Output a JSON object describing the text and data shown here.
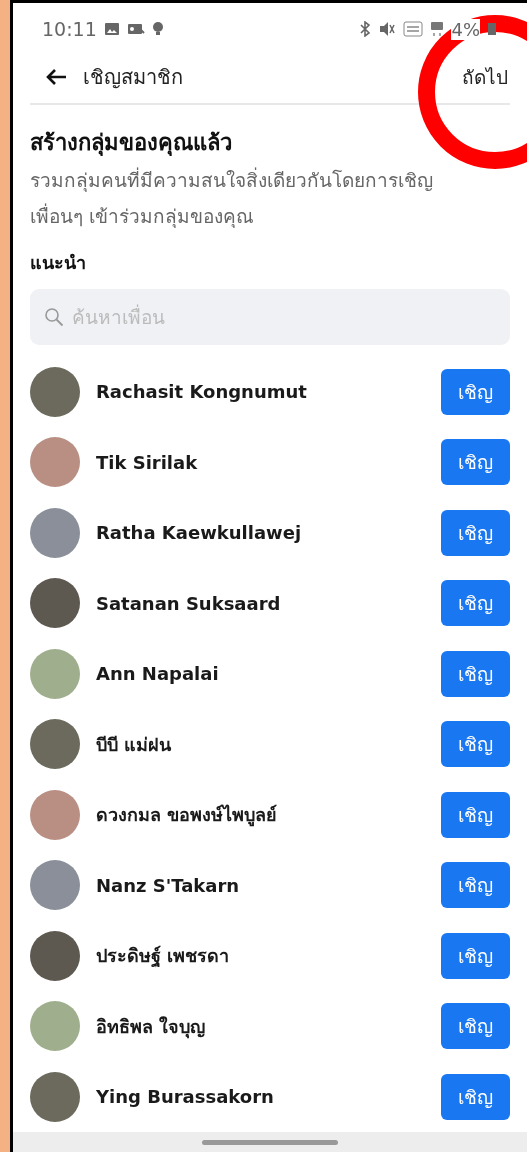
{
  "status_bar": {
    "time": "10:11",
    "battery": "4%"
  },
  "header": {
    "title": "เชิญสมาชิก",
    "action": "ถัดไป"
  },
  "intro": {
    "title": "สร้างกลุ่มของคุณแล้ว",
    "text": "รวมกลุ่มคนที่มีความสนใจสิ่งเดียวกันโดยการเชิญเพื่อนๆ เข้าร่วมกลุ่มของคุณ"
  },
  "section_title": "แนะนำ",
  "search": {
    "placeholder": "ค้นหาเพื่อน"
  },
  "friends": [
    {
      "name": "Rachasit Kongnumut",
      "button": "เชิญ"
    },
    {
      "name": "Tik Sirilak",
      "button": "เชิญ"
    },
    {
      "name": "Ratha Kaewkullawej",
      "button": "เชิญ"
    },
    {
      "name": "Satanan Suksaard",
      "button": "เชิญ"
    },
    {
      "name": "Ann Napalai",
      "button": "เชิญ"
    },
    {
      "name": "บีบี แม่ฝน",
      "button": "เชิญ"
    },
    {
      "name": "ดวงกมล ขอพงษ์ไพบูลย์",
      "button": "เชิญ"
    },
    {
      "name": "Nanz S'Takarn",
      "button": "เชิญ"
    },
    {
      "name": "ประดิษฐ์ เพชรดา",
      "button": "เชิญ"
    },
    {
      "name": "อิทธิพล ใจบุญ",
      "button": "เชิญ"
    },
    {
      "name": "Ying Burassakorn",
      "button": "เชิญ"
    }
  ]
}
